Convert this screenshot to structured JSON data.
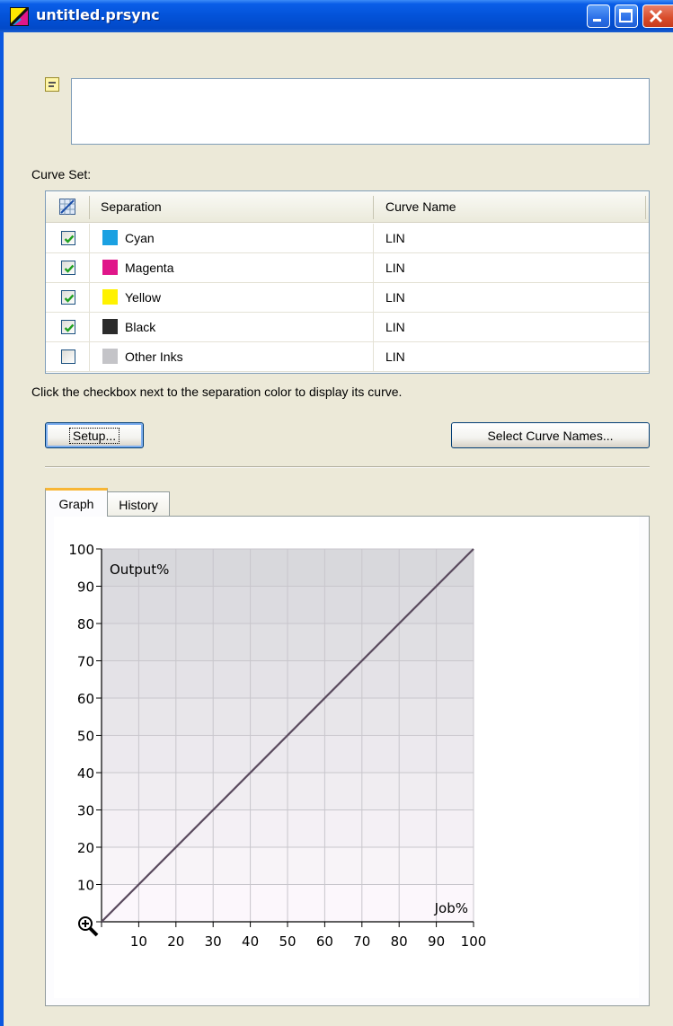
{
  "window": {
    "title": "untitled.prsync"
  },
  "curve_set": {
    "label": "Curve Set:",
    "columns": [
      "Separation",
      "Curve Name"
    ],
    "rows": [
      {
        "checked": true,
        "color": "#1ba1e2",
        "separation": "Cyan",
        "curve": "LIN"
      },
      {
        "checked": true,
        "color": "#e0168a",
        "separation": "Magenta",
        "curve": "LIN"
      },
      {
        "checked": true,
        "color": "#fff200",
        "separation": "Yellow",
        "curve": "LIN"
      },
      {
        "checked": true,
        "color": "#2b2b2b",
        "separation": "Black",
        "curve": "LIN"
      },
      {
        "checked": false,
        "color": "#c4c4c8",
        "separation": "Other Inks",
        "curve": "LIN"
      }
    ]
  },
  "hint": "Click the checkbox next to the separation color to display its curve.",
  "buttons": {
    "setup": "Setup...",
    "select_curve_names": "Select Curve Names..."
  },
  "tabs": [
    {
      "label": "Graph",
      "active": true
    },
    {
      "label": "History",
      "active": false
    }
  ],
  "chart_data": {
    "type": "line",
    "ylabel": "Output%",
    "xlabel": "Job%",
    "xlim": [
      0,
      100
    ],
    "ylim": [
      0,
      100
    ],
    "xticks": [
      10,
      20,
      30,
      40,
      50,
      60,
      70,
      80,
      90,
      100
    ],
    "yticks": [
      10,
      20,
      30,
      40,
      50,
      60,
      70,
      80,
      90,
      100
    ],
    "grid": true,
    "series": [
      {
        "color": "#5a4a5e",
        "x": [
          0,
          100
        ],
        "y": [
          0,
          100
        ]
      }
    ]
  }
}
